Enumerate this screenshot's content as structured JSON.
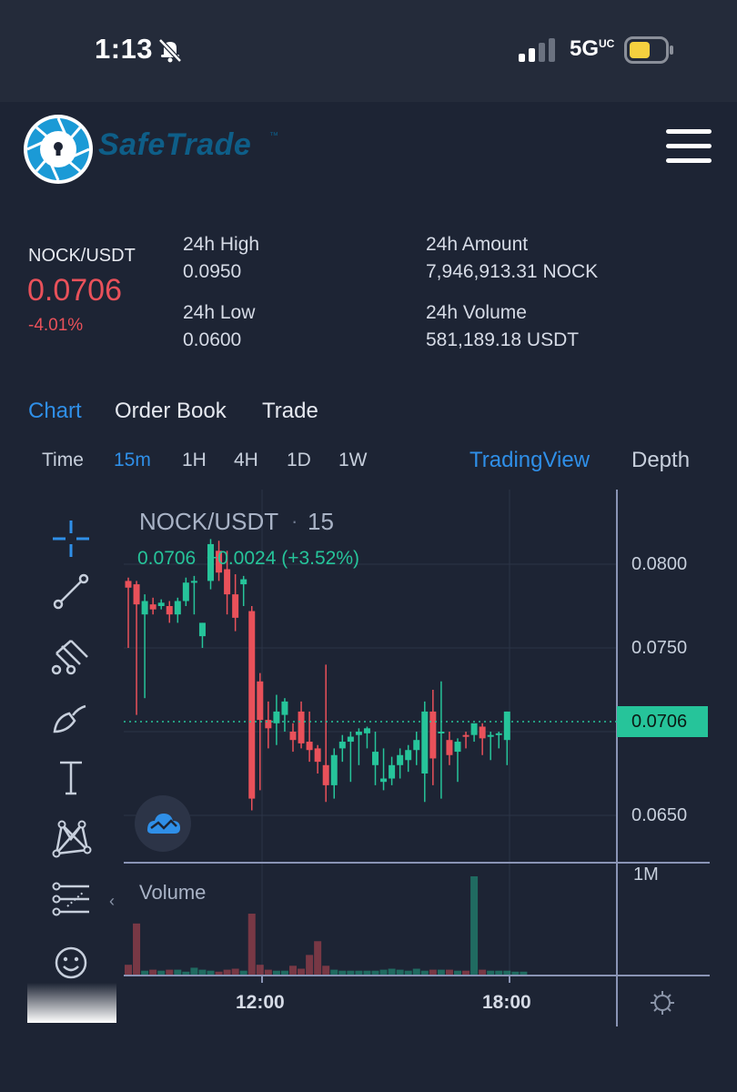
{
  "status_bar": {
    "time": "1:13",
    "network": "5G",
    "network_sup": "UC"
  },
  "brand": {
    "name": "SafeTrade",
    "tm": "™"
  },
  "ticker": {
    "pair": "NOCK/USDT",
    "price": "0.0706",
    "change": "-4.01%",
    "high_label": "24h High",
    "high": "0.0950",
    "low_label": "24h Low",
    "low": "0.0600",
    "amount_label": "24h Amount",
    "amount": "7,946,913.31 NOCK",
    "volume_label": "24h Volume",
    "volume": "581,189.18 USDT"
  },
  "tabs": [
    "Chart",
    "Order Book",
    "Trade"
  ],
  "intervals": {
    "time_label": "Time",
    "items": [
      "15m",
      "1H",
      "4H",
      "1D",
      "1W"
    ],
    "active": "15m"
  },
  "views": {
    "tradingview": "TradingView",
    "depth": "Depth"
  },
  "chart": {
    "title": "NOCK/USDT",
    "interval": "15",
    "ohlc_price": "0.0706",
    "ohlc_change": "+0.0024 (+3.52%)",
    "last_price": "0.0706",
    "price_axis": [
      "0.0800",
      "0.0750",
      "0.0650"
    ],
    "volume_axis": "1M",
    "volume_label": "Volume",
    "time_axis": [
      "12:00",
      "18:00"
    ],
    "colors": {
      "up": "#26c49a",
      "down": "#e9515a"
    }
  },
  "chart_data": {
    "type": "candlestick",
    "title": "NOCK/USDT",
    "y_ticks": [
      0.08,
      0.075,
      0.065
    ],
    "ylim": [
      0.0625,
      0.0835
    ],
    "last": 0.0706,
    "candles": [
      [
        0.079,
        0.0792,
        0.075,
        0.0786
      ],
      [
        0.0788,
        0.079,
        0.071,
        0.0776
      ],
      [
        0.077,
        0.0782,
        0.072,
        0.0778
      ],
      [
        0.0776,
        0.078,
        0.077,
        0.0773
      ],
      [
        0.0775,
        0.0779,
        0.0773,
        0.0777
      ],
      [
        0.0775,
        0.0778,
        0.0765,
        0.077
      ],
      [
        0.077,
        0.078,
        0.0765,
        0.0778
      ],
      [
        0.0778,
        0.0792,
        0.0775,
        0.0789
      ],
      [
        0.0789,
        0.0793,
        0.077,
        0.079
      ],
      [
        0.0757,
        0.0765,
        0.075,
        0.0765
      ],
      [
        0.079,
        0.0815,
        0.0785,
        0.0812
      ],
      [
        0.0808,
        0.0814,
        0.079,
        0.0795
      ],
      [
        0.0797,
        0.0808,
        0.077,
        0.0782
      ],
      [
        0.0782,
        0.0794,
        0.076,
        0.0768
      ],
      [
        0.0788,
        0.0793,
        0.0775,
        0.0791
      ],
      [
        0.0772,
        0.0775,
        0.0653,
        0.066
      ],
      [
        0.073,
        0.0735,
        0.0665,
        0.0707
      ],
      [
        0.0707,
        0.0718,
        0.069,
        0.0702
      ],
      [
        0.0705,
        0.0722,
        0.0692,
        0.0712
      ],
      [
        0.071,
        0.072,
        0.07,
        0.0718
      ],
      [
        0.07,
        0.0705,
        0.0688,
        0.0695
      ],
      [
        0.0712,
        0.0718,
        0.069,
        0.0693
      ],
      [
        0.0694,
        0.0712,
        0.0682,
        0.0689
      ],
      [
        0.069,
        0.0692,
        0.0675,
        0.0682
      ],
      [
        0.068,
        0.074,
        0.0658,
        0.0668
      ],
      [
        0.0668,
        0.069,
        0.066,
        0.0686
      ],
      [
        0.069,
        0.0698,
        0.0682,
        0.0694
      ],
      [
        0.0694,
        0.07,
        0.067,
        0.0697
      ],
      [
        0.0698,
        0.0702,
        0.068,
        0.07
      ],
      [
        0.0699,
        0.0703,
        0.069,
        0.0702
      ],
      [
        0.068,
        0.07,
        0.0668,
        0.0688
      ],
      [
        0.067,
        0.069,
        0.0665,
        0.0672
      ],
      [
        0.0672,
        0.0685,
        0.0668,
        0.068
      ],
      [
        0.068,
        0.069,
        0.0672,
        0.0686
      ],
      [
        0.0683,
        0.0692,
        0.0676,
        0.0689
      ],
      [
        0.0689,
        0.07,
        0.068,
        0.0695
      ],
      [
        0.0675,
        0.0718,
        0.0658,
        0.0712
      ],
      [
        0.0712,
        0.0725,
        0.0668,
        0.0684
      ],
      [
        0.07,
        0.073,
        0.066,
        0.07
      ],
      [
        0.0695,
        0.07,
        0.068,
        0.0686
      ],
      [
        0.0688,
        0.0696,
        0.067,
        0.0694
      ],
      [
        0.0698,
        0.07,
        0.069,
        0.0697
      ],
      [
        0.0698,
        0.0703,
        0.0694,
        0.0705
      ],
      [
        0.0703,
        0.0705,
        0.0686,
        0.0696
      ],
      [
        0.0697,
        0.07,
        0.0683,
        0.0698
      ],
      [
        0.0698,
        0.07,
        0.069,
        0.0699
      ],
      [
        0.0695,
        0.0712,
        0.068,
        0.0712
      ]
    ],
    "volume": [
      0.1,
      0.52,
      0.04,
      0.05,
      0.04,
      0.05,
      0.05,
      0.03,
      0.07,
      0.05,
      0.04,
      0.03,
      0.05,
      0.06,
      0.04,
      0.62,
      0.1,
      0.05,
      0.04,
      0.04,
      0.09,
      0.06,
      0.2,
      0.34,
      0.09,
      0.05,
      0.04,
      0.04,
      0.04,
      0.04,
      0.04,
      0.05,
      0.06,
      0.05,
      0.04,
      0.06,
      0.04,
      0.05,
      0.05,
      0.05,
      0.04,
      0.04,
      1.0,
      0.05,
      0.04,
      0.04,
      0.04,
      0.03,
      0.03
    ]
  }
}
